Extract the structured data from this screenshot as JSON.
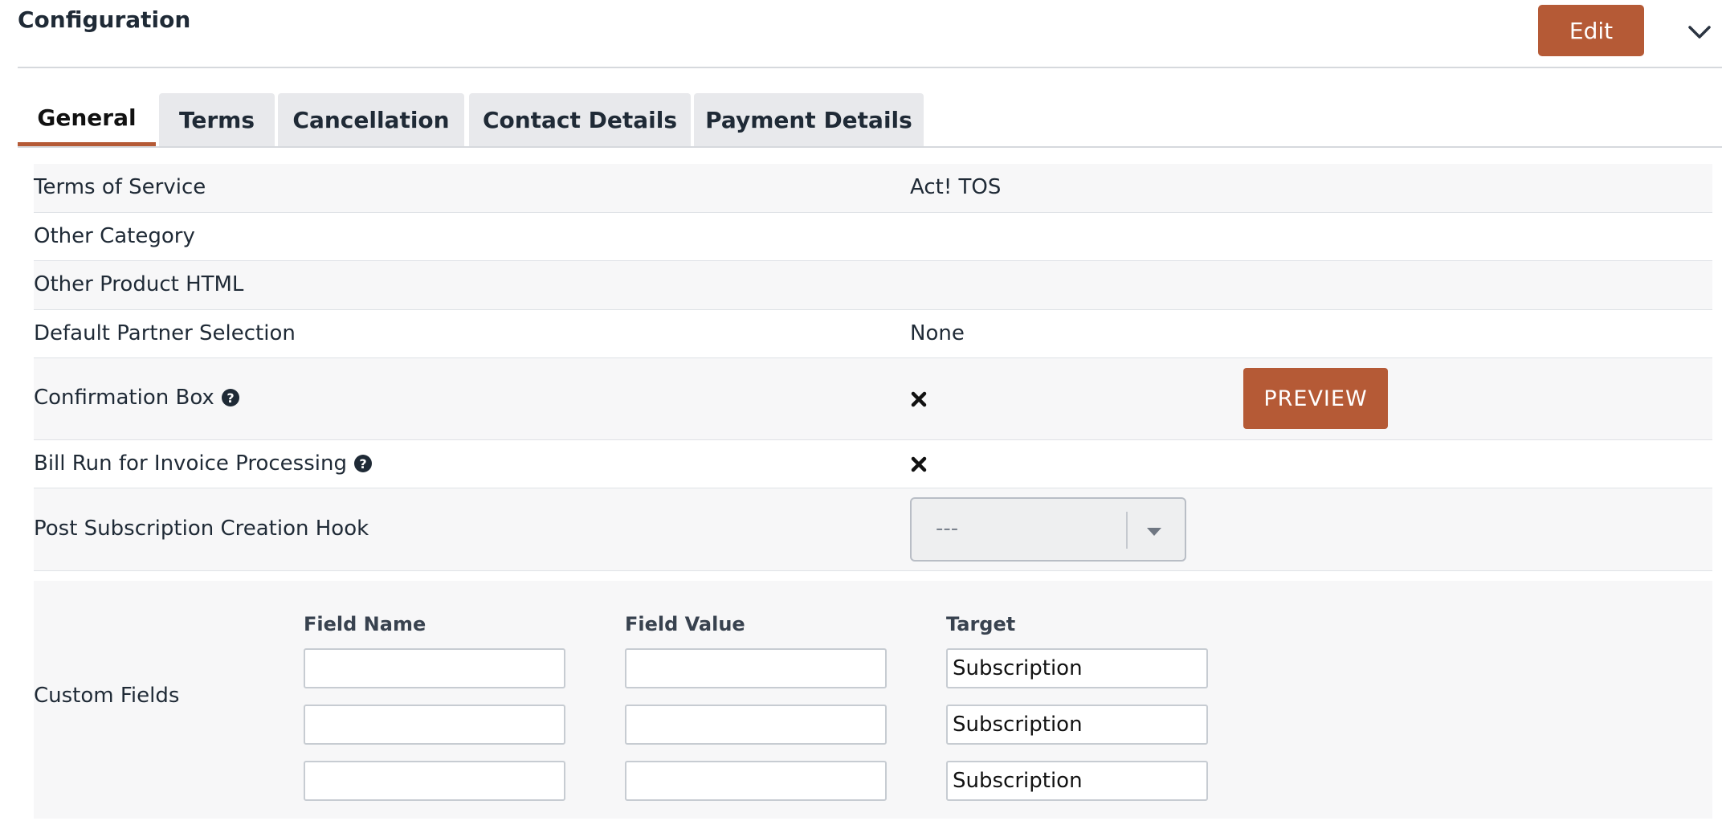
{
  "header": {
    "title": "Configuration",
    "edit_label": "Edit"
  },
  "tabs": [
    {
      "label": "General",
      "active": true
    },
    {
      "label": "Terms",
      "active": false
    },
    {
      "label": "Cancellation",
      "active": false
    },
    {
      "label": "Contact Details",
      "active": false
    },
    {
      "label": "Payment Details",
      "active": false
    }
  ],
  "rows": {
    "terms_of_service": {
      "label": "Terms of Service",
      "value": "Act! TOS"
    },
    "other_category": {
      "label": "Other Category",
      "value": ""
    },
    "other_product_html": {
      "label": "Other Product HTML",
      "value": ""
    },
    "default_partner": {
      "label": "Default Partner Selection",
      "value": "None"
    },
    "confirmation_box": {
      "label": "Confirmation Box",
      "enabled": false,
      "preview_label": "PREVIEW"
    },
    "bill_run": {
      "label": "Bill Run for Invoice Processing",
      "enabled": false
    },
    "post_hook": {
      "label": "Post Subscription Creation Hook",
      "selected": "---"
    }
  },
  "custom_fields": {
    "label": "Custom Fields",
    "headers": {
      "name": "Field Name",
      "value": "Field Value",
      "target": "Target"
    },
    "rows": [
      {
        "name": "",
        "value": "",
        "target": "Subscription"
      },
      {
        "name": "",
        "value": "",
        "target": "Subscription"
      },
      {
        "name": "",
        "value": "",
        "target": "Subscription"
      }
    ]
  },
  "icons": {
    "help": "question-circle-icon",
    "disabled": "x-mark-icon",
    "dropdown": "caret-down-icon",
    "collapse": "chevron-down-icon"
  },
  "colors": {
    "accent": "#b55a36",
    "row_alt": "#f7f7f8",
    "tab_bg": "#e8e9ec",
    "text": "#1f2a36"
  }
}
